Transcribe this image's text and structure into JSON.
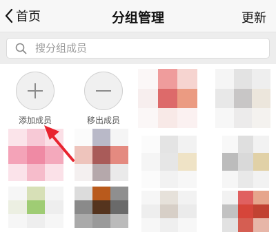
{
  "nav": {
    "back_label": "首页",
    "title": "分组管理",
    "update_label": "更新"
  },
  "search": {
    "placeholder": "搜分组成员"
  },
  "actions": {
    "add_label": "添加成员",
    "remove_label": "移出成员"
  },
  "colors": {
    "navbar_bg": "#f7f7f7",
    "search_bar_bg": "#ededed",
    "arrow": "#e8242f"
  },
  "members": [
    {
      "pixels": [
        "#fbf7f7",
        "#ef9c9c",
        "#f6d4d0",
        "#f7eeee",
        "#dd6a6a",
        "#eb9b82",
        "#fbf7f7",
        "#f8e9e7",
        "#fbf1f1"
      ]
    },
    {
      "pixels": [
        "#f5f5f5",
        "#e3e3e3",
        "#eeeeee",
        "#e8e8e8",
        "#c8c6c6",
        "#ece6dc",
        "#f7f7f7",
        "#ecebeb",
        "#f4f2ef"
      ]
    },
    {
      "pixels": [
        "#fbe4ea",
        "#f7c9d6",
        "#fbdfe6",
        "#f4a3b8",
        "#ef8aa4",
        "#f4a9bc",
        "#fbe3ea",
        "#f6bccb",
        "#fbe1e8"
      ]
    },
    {
      "pixels": [
        "#fbfbfb",
        "#b9b9c8",
        "#f5f5f5",
        "#eec4bc",
        "#a95b59",
        "#e48a80",
        "#f4f0f0",
        "#b5a8ab",
        "#eaeaea"
      ]
    },
    {
      "pixels": [
        "#fbfbfb",
        "#e4e4e4",
        "#f2f2f2",
        "#f5f5f5",
        "#e6e6e6",
        "#efe3c6",
        "#fbfbfb",
        "#f2f2f2",
        "#f7f7f7"
      ]
    },
    {
      "pixels": [
        "#f8f8f8",
        "#dfdfdf",
        "#f2f2f2",
        "#bcbcbc",
        "#d9d9d9",
        "#e1d1a7",
        "#f6f6f6",
        "#e9e9e9",
        "#f2f2f2"
      ]
    },
    {
      "pixels": [
        "#f6f6f6",
        "#d7e0b7",
        "#f4f4f4",
        "#ecefe2",
        "#9fcc74",
        "#eeeeee",
        "#f6f6f6",
        "#eeeeee",
        "#f6f6f6"
      ]
    },
    {
      "pixels": [
        "#dcdcdc",
        "#b95a1c",
        "#8f8f8f",
        "#8a8a8a",
        "#55341e",
        "#6a6a6a",
        "#aaaaaa",
        "#9a9a9a",
        "#bbbbbb"
      ]
    },
    {
      "pixels": [
        "#f6f6f6",
        "#e6e1da",
        "#f2f2f2",
        "#eeeeee",
        "#d7cfc7",
        "#ebebeb",
        "#f7f7f7",
        "#efefef",
        "#f7f7f7"
      ]
    },
    {
      "pixels": [
        "#f2f2f2",
        "#e06060",
        "#e6a58c",
        "#c2c2c2",
        "#d6453a",
        "#c14232",
        "#e2e2e2",
        "#d55e52",
        "#e7b6a8"
      ]
    }
  ]
}
